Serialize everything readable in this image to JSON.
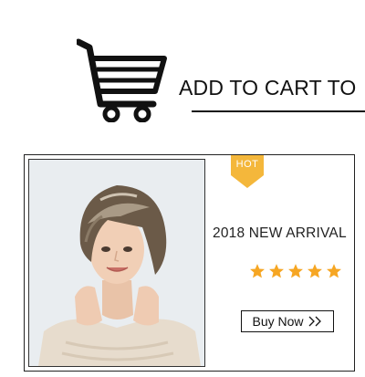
{
  "header": {
    "cart_icon": "shopping-cart-icon",
    "title": "ADD TO CART TO"
  },
  "product": {
    "image_subject": "woman-short-wig-photo",
    "badge": "HOT",
    "badge_color": "#f4b73b",
    "headline": "2018 NEW ARRIVAL",
    "rating": 5,
    "star_color": "#f6a623",
    "buy_button": "Buy Now",
    "buy_icon": "double-chevron-right-icon"
  }
}
